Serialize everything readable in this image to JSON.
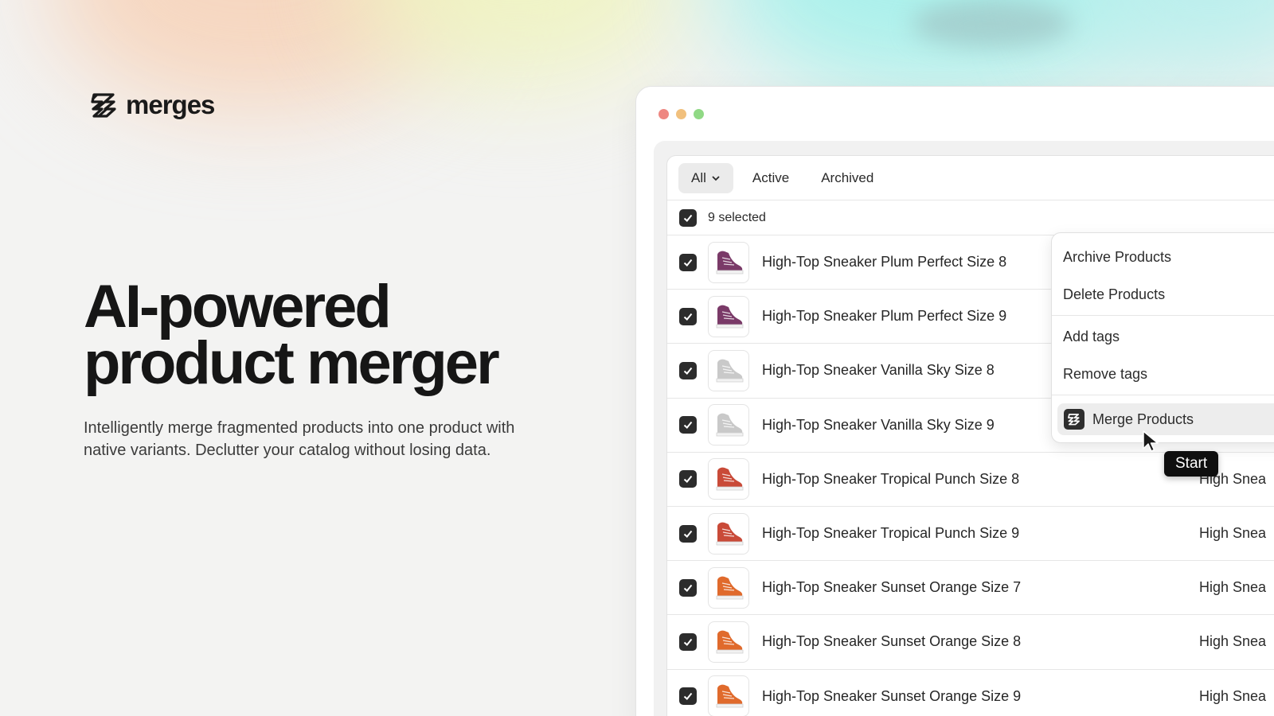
{
  "brand": {
    "name": "merges"
  },
  "hero": {
    "title_line1": "AI-powered",
    "title_line2": "product merger",
    "subtitle": "Intelligently merge fragmented products into one product with native variants. Declutter your catalog without losing data."
  },
  "tabs": [
    {
      "label": "All",
      "active": true
    },
    {
      "label": "Active",
      "active": false
    },
    {
      "label": "Archived",
      "active": false
    }
  ],
  "selection": {
    "label": "9 selected",
    "checked": true
  },
  "products": [
    {
      "name": "High-Top Sneaker Plum Perfect Size 8",
      "thumb_color": "#7a3a68",
      "right_text": "",
      "checked": true
    },
    {
      "name": "High-Top Sneaker Plum Perfect Size 9",
      "thumb_color": "#7a3a68",
      "right_text": "",
      "checked": true
    },
    {
      "name": "High-Top Sneaker Vanilla Sky Size 8",
      "thumb_color": "#c9c9c9",
      "right_text": "",
      "checked": true
    },
    {
      "name": "High-Top Sneaker Vanilla Sky Size 9",
      "thumb_color": "#c9c9c9",
      "right_text": "",
      "checked": true
    },
    {
      "name": "High-Top Sneaker Tropical Punch Size 8",
      "thumb_color": "#c94a38",
      "right_text": "High Snea",
      "checked": true
    },
    {
      "name": "High-Top Sneaker Tropical Punch Size 9",
      "thumb_color": "#c94a38",
      "right_text": "High Snea",
      "checked": true
    },
    {
      "name": "High-Top Sneaker Sunset Orange Size 7",
      "thumb_color": "#e06a2c",
      "right_text": "High Snea",
      "checked": true
    },
    {
      "name": "High-Top Sneaker Sunset Orange Size 8",
      "thumb_color": "#e06a2c",
      "right_text": "High Snea",
      "checked": true
    },
    {
      "name": "High-Top Sneaker Sunset Orange Size 9",
      "thumb_color": "#e06a2c",
      "right_text": "High Snea",
      "checked": true
    }
  ],
  "menu": {
    "archive": "Archive Products",
    "delete": "Delete Products",
    "add_tags": "Add tags",
    "remove_tags": "Remove tags",
    "merge": "Merge Products"
  },
  "tooltip": {
    "label": "Start"
  },
  "colors": {
    "checkbox": "#2c2c2c",
    "traffic_red": "#ee8781",
    "traffic_yellow": "#f1c07d",
    "traffic_green": "#90d985"
  }
}
